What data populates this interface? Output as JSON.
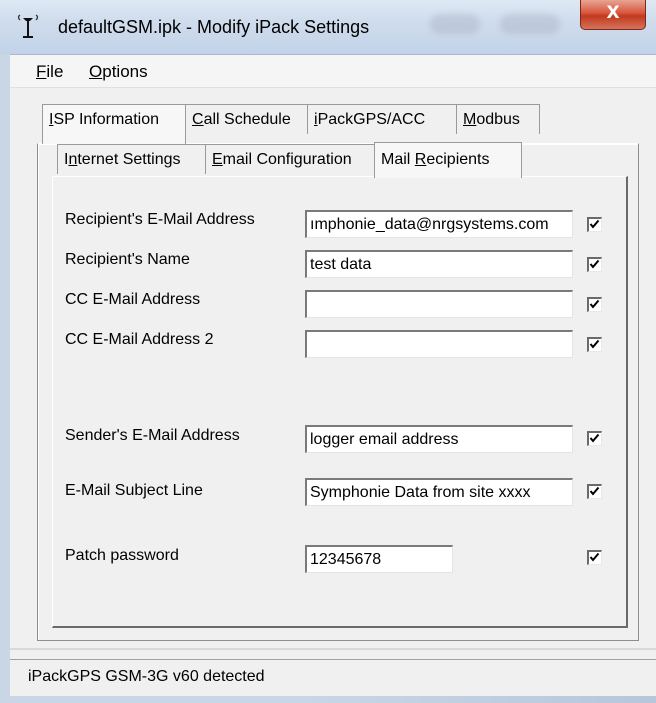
{
  "window": {
    "title": "defaultGSM.ipk - Modify iPack Settings",
    "close_glyph": "X",
    "icon": "antenna-icon"
  },
  "menu": {
    "file": {
      "prefix": "",
      "accel": "F",
      "rest": "ile"
    },
    "options": {
      "prefix": "",
      "accel": "O",
      "rest": "ptions"
    }
  },
  "tabs_top": [
    {
      "prefix": "",
      "accel": "I",
      "rest": "SP Information"
    },
    {
      "prefix": "",
      "accel": "C",
      "rest": "all Schedule"
    },
    {
      "prefix": "",
      "accel": "i",
      "rest": "PackGPS/ACC"
    },
    {
      "prefix": "",
      "accel": "M",
      "rest": "odbus"
    }
  ],
  "tabs_sub": [
    {
      "prefix": "I",
      "accel": "n",
      "rest": "ternet Settings"
    },
    {
      "prefix": "",
      "accel": "E",
      "rest": "mail Configuration"
    },
    {
      "prefix": "Mail ",
      "accel": "R",
      "rest": "ecipients"
    }
  ],
  "form": {
    "recipient_email_label": "Recipient's E-Mail Address",
    "recipient_email_value": "ımphonie_data@nrgsystems.com",
    "recipient_name_label": "Recipient's Name",
    "recipient_name_value": "test data",
    "cc_email_label": "CC E-Mail Address",
    "cc_email_value": "",
    "cc_email2_label": "CC E-Mail Address 2",
    "cc_email2_value": "",
    "sender_email_label": "Sender's E-Mail Address",
    "sender_email_value": "logger email address",
    "subject_label": "E-Mail Subject Line",
    "subject_value": "Symphonie Data from site xxxx",
    "patch_password_label": "Patch password",
    "patch_password_value": "12345678"
  },
  "checkboxes": {
    "recipient_email": true,
    "recipient_name": true,
    "cc_email": true,
    "cc_email2": true,
    "sender_email": true,
    "subject": true,
    "patch_password": true
  },
  "status_bar": {
    "text": "iPackGPS GSM-3G v60 detected"
  }
}
